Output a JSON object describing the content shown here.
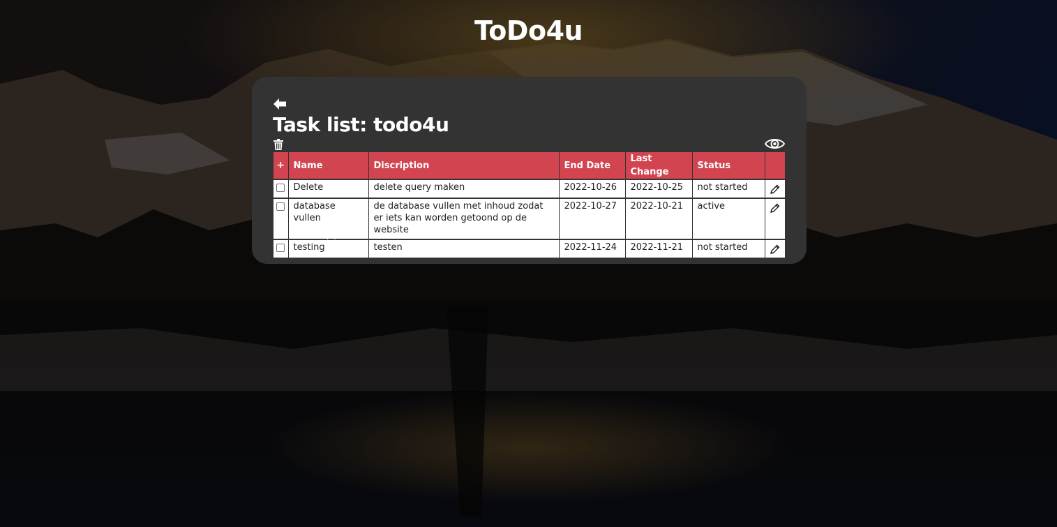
{
  "app": {
    "title": "ToDo4u"
  },
  "panel": {
    "title": "Task list: todo4u",
    "delete_label": "Delete task(s)"
  },
  "table": {
    "add_label": "+",
    "columns": [
      "Name",
      "Discription",
      "End Date",
      "Last Change",
      "Status"
    ],
    "rows": [
      {
        "name": "Delete",
        "description": "delete query maken",
        "end_date": "2022-10-26",
        "last_change": "2022-10-25",
        "status": "not started"
      },
      {
        "name": "database vullen",
        "description": "de database vullen met inhoud zodat er iets kan worden getoond op de website",
        "end_date": "2022-10-27",
        "last_change": "2022-10-21",
        "status": "active"
      },
      {
        "name": "testing",
        "description": "testen",
        "end_date": "2022-11-24",
        "last_change": "2022-11-21",
        "status": "not started"
      }
    ]
  },
  "icons": {
    "back": "back-arrow-icon",
    "trash": "trash-icon",
    "eye": "eye-icon",
    "edit": "pencil-icon"
  },
  "colors": {
    "header_accent": "#d14450",
    "panel_bg": "#333333",
    "text_light": "#ffffff"
  }
}
